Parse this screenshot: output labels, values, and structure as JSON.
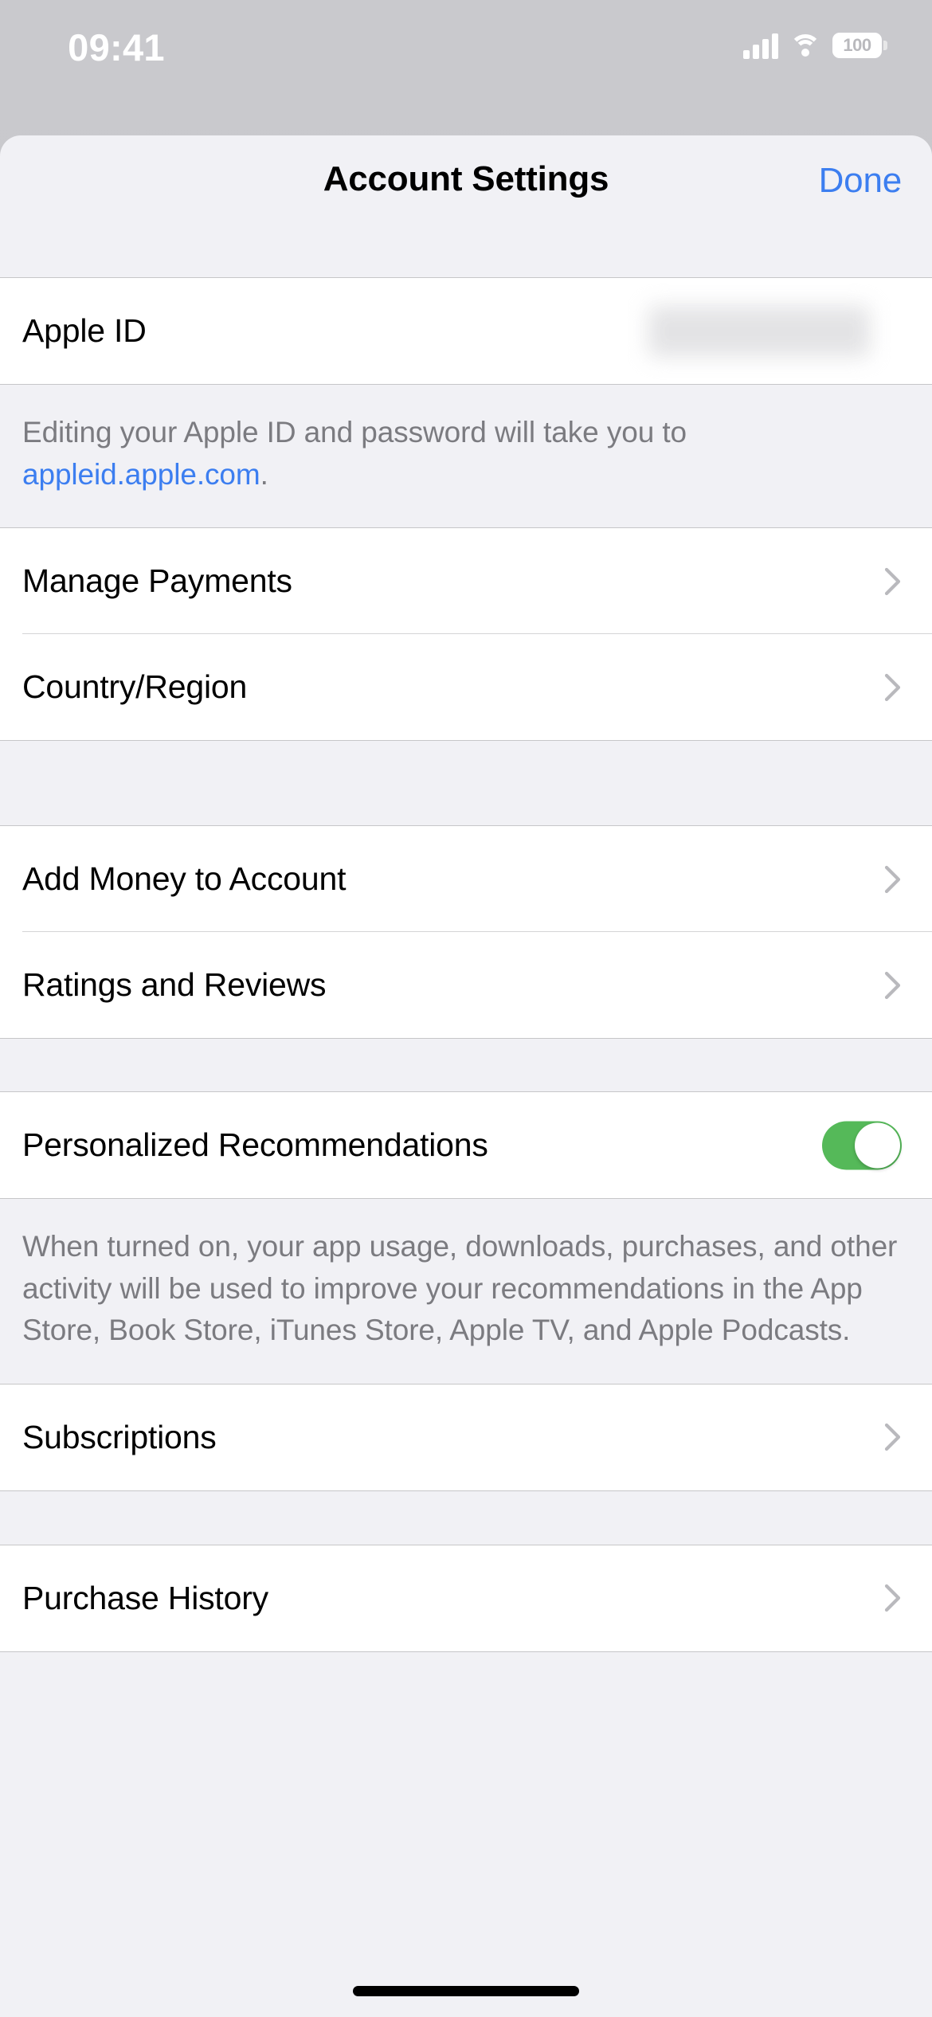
{
  "status_bar": {
    "time": "09:41",
    "battery_level": "100",
    "cellular_icon": "cellular-signal-icon",
    "wifi_icon": "wifi-icon",
    "battery_icon": "battery-icon"
  },
  "nav": {
    "title": "Account Settings",
    "done_label": "Done",
    "done_color": "#3C7EF0"
  },
  "sections": {
    "apple_id": {
      "rows": [
        {
          "label": "Apple ID",
          "value": "",
          "value_redacted": true,
          "chevron": false
        }
      ],
      "footer_prefix": "Editing your Apple ID and password will take you to ",
      "footer_link": "appleid.apple.com",
      "footer_suffix": "."
    },
    "payments": {
      "rows": [
        {
          "label": "Manage Payments",
          "chevron": true
        },
        {
          "label": "Country/Region",
          "chevron": true
        }
      ]
    },
    "money": {
      "rows": [
        {
          "label": "Add Money to Account",
          "chevron": true
        },
        {
          "label": "Ratings and Reviews",
          "chevron": true
        }
      ]
    },
    "recommendations": {
      "rows": [
        {
          "label": "Personalized Recommendations",
          "toggle": true,
          "toggle_on": true
        }
      ],
      "footer": "When turned on, your app usage, downloads, purchases, and other activity will be used to improve your recommendations in the App Store, Book Store, iTunes Store, Apple TV, and Apple Podcasts."
    },
    "subscriptions": {
      "rows": [
        {
          "label": "Subscriptions",
          "chevron": true
        }
      ]
    },
    "purchases": {
      "rows": [
        {
          "label": "Purchase History",
          "chevron": true
        }
      ]
    }
  },
  "colors": {
    "accent_blue": "#3C7EF0",
    "toggle_green": "#55B959",
    "group_bg": "#FFFFFF",
    "page_bg": "#F1F1F5",
    "footer_text": "#7B7B80",
    "separator": "#D4D4D6"
  },
  "home_indicator": "home-indicator"
}
